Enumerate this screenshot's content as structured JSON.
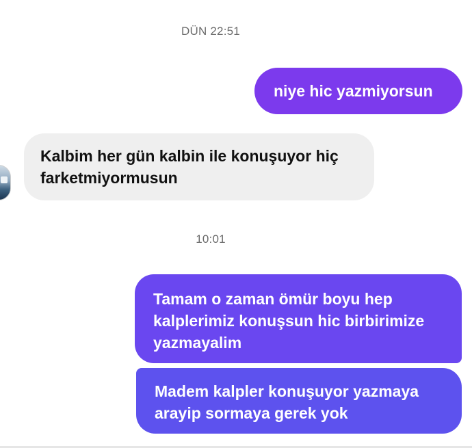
{
  "conversation": {
    "timestamps": [
      "DÜN 22:51",
      "10:01"
    ],
    "messages": [
      {
        "direction": "outgoing",
        "lines": [
          "niye hic yazmiyorsun"
        ]
      },
      {
        "direction": "incoming",
        "lines": [
          "Kalbim her gün kalbin ile konuşuyor hiç",
          "farketmiyormusun"
        ]
      },
      {
        "direction": "outgoing",
        "lines": [
          "Tamam o zaman ömür boyu hep",
          "kalplerimiz konuşsun hic birbirimize",
          "yazmayalim"
        ]
      },
      {
        "direction": "outgoing",
        "lines": [
          "Madem kalpler konuşuyor yazmaya",
          "arayip sormaya gerek yok"
        ]
      }
    ]
  },
  "colors": {
    "outgoing_1": "#7c3aed",
    "outgoing_2": "#6a47f0",
    "outgoing_3": "#5d52ee",
    "incoming": "#efefef",
    "timestamp_text": "#6b6b6b"
  },
  "icons": {
    "avatar": "contact-avatar-photo"
  }
}
